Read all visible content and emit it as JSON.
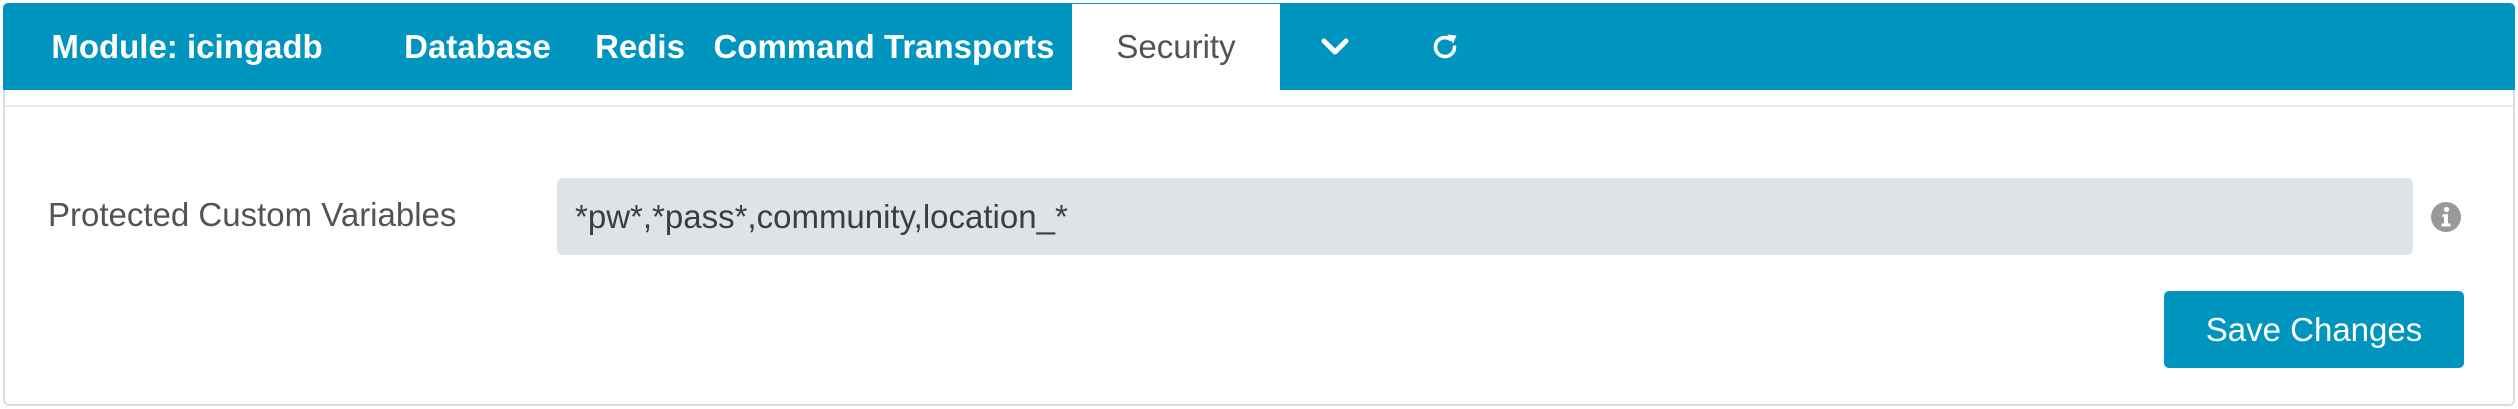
{
  "tabs": {
    "module_label": "Module: icingadb",
    "database_label": "Database",
    "redis_label": "Redis",
    "command_transports_label": "Command Transports",
    "security_label": "Security",
    "more_icon": "chevron-down-icon",
    "refresh_icon": "refresh-icon",
    "active": "Security"
  },
  "form": {
    "protected_vars_label": "Protected Custom Variables",
    "protected_vars_value": "*pw*,*pass*,community,location_*",
    "info_icon": "info-icon",
    "save_label": "Save Changes"
  },
  "colors": {
    "accent": "#0095bf",
    "input_bg": "#dde3e6",
    "text": "#535353",
    "icon_gray": "#999999"
  }
}
